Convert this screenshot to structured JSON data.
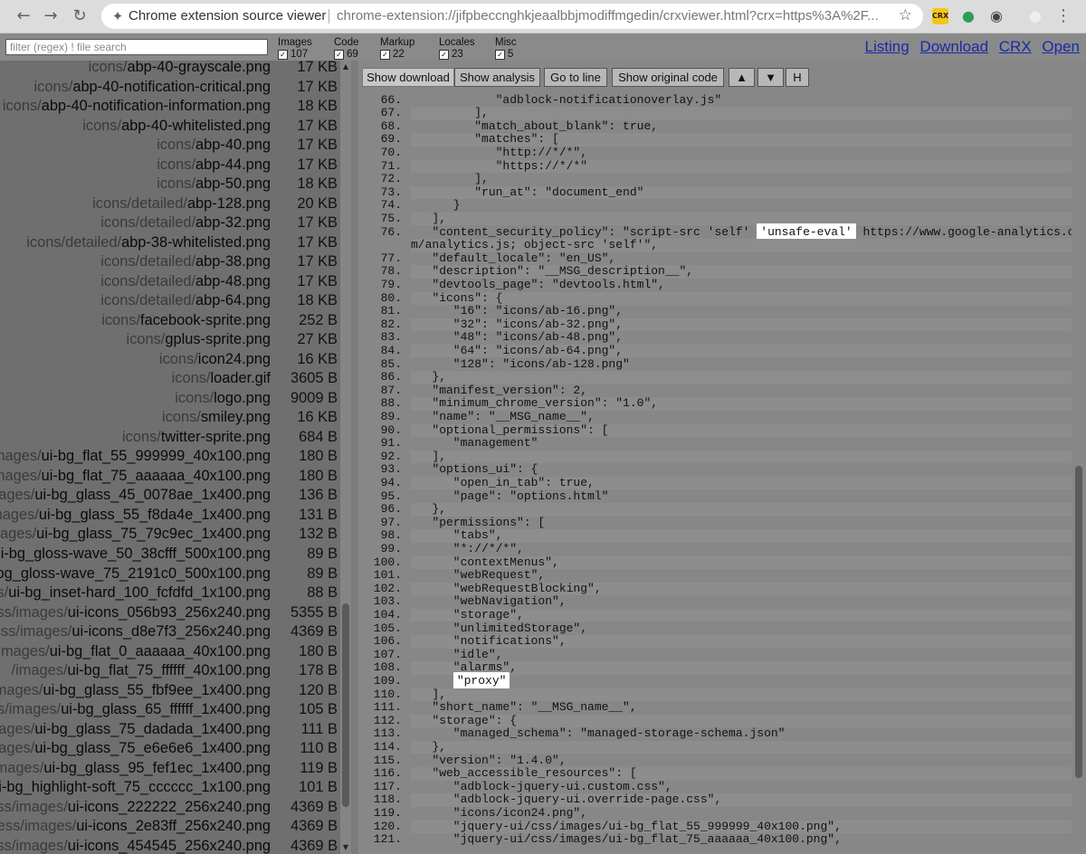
{
  "browser": {
    "tab_title": "Chrome extension source viewer",
    "url": "chrome-extension://jifpbeccnghkjeaalbbjmodiffmgedin/crxviewer.html?crx=https%3A%2F...",
    "nav": {
      "back_icon": "arrow-left-icon",
      "forward_icon": "arrow-right-icon",
      "reload_icon": "reload-icon"
    },
    "extensions": [
      {
        "name": "crx-icon",
        "label": "CRX",
        "color": "#f5c518"
      },
      {
        "name": "green-extension-icon",
        "label": "●",
        "color": "#2e9e57"
      },
      {
        "name": "shield-extension-icon",
        "label": "◉",
        "color": "#444444"
      },
      {
        "name": "account-icon",
        "label": "●",
        "color": "#eeeeee"
      }
    ]
  },
  "toolbar": {
    "filter_placeholder": "filter (regex) ! file search",
    "filters": [
      {
        "label": "Images",
        "count": "107"
      },
      {
        "label": "Code",
        "count": "69"
      },
      {
        "label": "Markup",
        "count": "22"
      },
      {
        "label": "Locales",
        "count": "23"
      },
      {
        "label": "Misc",
        "count": "5"
      }
    ],
    "links": [
      "Listing",
      "Download",
      "CRX",
      "Open"
    ]
  },
  "files": [
    {
      "dir": "icons/",
      "base": "abp-40-grayscale.png",
      "size": "17 KB"
    },
    {
      "dir": "icons/",
      "base": "abp-40-notification-critical.png",
      "size": "17 KB"
    },
    {
      "dir": "icons/",
      "base": "abp-40-notification-information.png",
      "size": "18 KB"
    },
    {
      "dir": "icons/",
      "base": "abp-40-whitelisted.png",
      "size": "17 KB"
    },
    {
      "dir": "icons/",
      "base": "abp-40.png",
      "size": "17 KB"
    },
    {
      "dir": "icons/",
      "base": "abp-44.png",
      "size": "17 KB"
    },
    {
      "dir": "icons/",
      "base": "abp-50.png",
      "size": "18 KB"
    },
    {
      "dir": "icons/detailed/",
      "base": "abp-128.png",
      "size": "20 KB"
    },
    {
      "dir": "icons/detailed/",
      "base": "abp-32.png",
      "size": "17 KB"
    },
    {
      "dir": "icons/detailed/",
      "base": "abp-38-whitelisted.png",
      "size": "17 KB"
    },
    {
      "dir": "icons/detailed/",
      "base": "abp-38.png",
      "size": "17 KB"
    },
    {
      "dir": "icons/detailed/",
      "base": "abp-48.png",
      "size": "17 KB"
    },
    {
      "dir": "icons/detailed/",
      "base": "abp-64.png",
      "size": "18 KB"
    },
    {
      "dir": "icons/",
      "base": "facebook-sprite.png",
      "size": "252 B"
    },
    {
      "dir": "icons/",
      "base": "gplus-sprite.png",
      "size": "27 KB"
    },
    {
      "dir": "icons/",
      "base": "icon24.png",
      "size": "16 KB"
    },
    {
      "dir": "icons/",
      "base": "loader.gif",
      "size": "3605 B"
    },
    {
      "dir": "icons/",
      "base": "logo.png",
      "size": "9009 B"
    },
    {
      "dir": "icons/",
      "base": "smiley.png",
      "size": "16 KB"
    },
    {
      "dir": "icons/",
      "base": "twitter-sprite.png",
      "size": "684 B"
    },
    {
      "dir": "/images/",
      "base": "ui-bg_flat_55_999999_40x100.png",
      "size": "180 B"
    },
    {
      "dir": "/images/",
      "base": "ui-bg_flat_75_aaaaaa_40x100.png",
      "size": "180 B"
    },
    {
      "dir": "images/",
      "base": "ui-bg_glass_45_0078ae_1x400.png",
      "size": "136 B"
    },
    {
      "dir": "images/",
      "base": "ui-bg_glass_55_f8da4e_1x400.png",
      "size": "131 B"
    },
    {
      "dir": "images/",
      "base": "ui-bg_glass_75_79c9ec_1x400.png",
      "size": "132 B"
    },
    {
      "dir": "/",
      "base": "ui-bg_gloss-wave_50_38cfff_500x100.png",
      "size": "89 B"
    },
    {
      "dir": "",
      "base": "ui-bg_gloss-wave_75_2191c0_500x100.png",
      "size": "89 B"
    },
    {
      "dir": "es/",
      "base": "ui-bg_inset-hard_100_fcfdfd_1x100.png",
      "size": "88 B"
    },
    {
      "dir": "/css/images/",
      "base": "ui-icons_056b93_256x240.png",
      "size": "5355 B"
    },
    {
      "dir": "/css/images/",
      "base": "ui-icons_d8e7f3_256x240.png",
      "size": "4369 B"
    },
    {
      "dir": "s/images/",
      "base": "ui-bg_flat_0_aaaaaa_40x100.png",
      "size": "180 B"
    },
    {
      "dir": "/images/",
      "base": "ui-bg_flat_75_ffffff_40x100.png",
      "size": "178 B"
    },
    {
      "dir": "/images/",
      "base": "ui-bg_glass_55_fbf9ee_1x400.png",
      "size": "120 B"
    },
    {
      "dir": "ss/images/",
      "base": "ui-bg_glass_65_ffffff_1x400.png",
      "size": "105 B"
    },
    {
      "dir": "/images/",
      "base": "ui-bg_glass_75_dadada_1x400.png",
      "size": "111 B"
    },
    {
      "dir": "s/images/",
      "base": "ui-bg_glass_75_e6e6e6_1x400.png",
      "size": "110 B"
    },
    {
      "dir": "s/images/",
      "base": "ui-bg_glass_95_fef1ec_1x400.png",
      "size": "119 B"
    },
    {
      "dir": "/",
      "base": "ui-bg_highlight-soft_75_cccccc_1x100.png",
      "size": "101 B"
    },
    {
      "dir": "ness/images/",
      "base": "ui-icons_222222_256x240.png",
      "size": "4369 B"
    },
    {
      "dir": "ness/images/",
      "base": "ui-icons_2e83ff_256x240.png",
      "size": "4369 B"
    },
    {
      "dir": "ness/images/",
      "base": "ui-icons_454545_256x240.png",
      "size": "4369 B"
    }
  ],
  "code_toolbar": {
    "show_download": "Show download",
    "buttons": [
      "Show analysis",
      "Go to line",
      "Show original code",
      "▲",
      "▼",
      "H"
    ]
  },
  "code_lines": [
    {
      "n": "66.",
      "t": "            \"adblock-notificationoverlay.js\""
    },
    {
      "n": "67.",
      "t": "         ],"
    },
    {
      "n": "68.",
      "t": "         \"match_about_blank\": true,"
    },
    {
      "n": "69.",
      "t": "         \"matches\": ["
    },
    {
      "n": "70.",
      "t": "            \"http://*/*\","
    },
    {
      "n": "71.",
      "t": "            \"https://*/*\""
    },
    {
      "n": "72.",
      "t": "         ],"
    },
    {
      "n": "73.",
      "t": "         \"run_at\": \"document_end\""
    },
    {
      "n": "74.",
      "t": "      }"
    },
    {
      "n": "75.",
      "t": "   ],"
    },
    {
      "n": "76.",
      "t": "   \"content_security_policy\": \"script-src 'self' ",
      "hl": "'unsafe-eval'",
      "after": " https://www.google-analytics.co"
    },
    {
      "n": "",
      "t": "m/analytics.js; object-src 'self'\","
    },
    {
      "n": "77.",
      "t": "   \"default_locale\": \"en_US\","
    },
    {
      "n": "78.",
      "t": "   \"description\": \"__MSG_description__\","
    },
    {
      "n": "79.",
      "t": "   \"devtools_page\": \"devtools.html\","
    },
    {
      "n": "80.",
      "t": "   \"icons\": {"
    },
    {
      "n": "81.",
      "t": "      \"16\": \"icons/ab-16.png\","
    },
    {
      "n": "82.",
      "t": "      \"32\": \"icons/ab-32.png\","
    },
    {
      "n": "83.",
      "t": "      \"48\": \"icons/ab-48.png\","
    },
    {
      "n": "84.",
      "t": "      \"64\": \"icons/ab-64.png\","
    },
    {
      "n": "85.",
      "t": "      \"128\": \"icons/ab-128.png\""
    },
    {
      "n": "86.",
      "t": "   },"
    },
    {
      "n": "87.",
      "t": "   \"manifest_version\": 2,"
    },
    {
      "n": "88.",
      "t": "   \"minimum_chrome_version\": \"1.0\","
    },
    {
      "n": "89.",
      "t": "   \"name\": \"__MSG_name__\","
    },
    {
      "n": "90.",
      "t": "   \"optional_permissions\": ["
    },
    {
      "n": "91.",
      "t": "      \"management\""
    },
    {
      "n": "92.",
      "t": "   ],"
    },
    {
      "n": "93.",
      "t": "   \"options_ui\": {"
    },
    {
      "n": "94.",
      "t": "      \"open_in_tab\": true,"
    },
    {
      "n": "95.",
      "t": "      \"page\": \"options.html\""
    },
    {
      "n": "96.",
      "t": "   },"
    },
    {
      "n": "97.",
      "t": "   \"permissions\": ["
    },
    {
      "n": "98.",
      "t": "      \"tabs\","
    },
    {
      "n": "99.",
      "t": "      \"*://*/*\","
    },
    {
      "n": "100.",
      "t": "      \"contextMenus\","
    },
    {
      "n": "101.",
      "t": "      \"webRequest\","
    },
    {
      "n": "102.",
      "t": "      \"webRequestBlocking\","
    },
    {
      "n": "103.",
      "t": "      \"webNavigation\","
    },
    {
      "n": "104.",
      "t": "      \"storage\","
    },
    {
      "n": "105.",
      "t": "      \"unlimitedStorage\","
    },
    {
      "n": "106.",
      "t": "      \"notifications\","
    },
    {
      "n": "107.",
      "t": "      \"idle\","
    },
    {
      "n": "108.",
      "t": "      \"alarms\","
    },
    {
      "n": "109.",
      "t": "      ",
      "hl": "\"proxy\"",
      "after": ""
    },
    {
      "n": "110.",
      "t": "   ],"
    },
    {
      "n": "111.",
      "t": "   \"short_name\": \"__MSG_name__\","
    },
    {
      "n": "112.",
      "t": "   \"storage\": {"
    },
    {
      "n": "113.",
      "t": "      \"managed_schema\": \"managed-storage-schema.json\""
    },
    {
      "n": "114.",
      "t": "   },"
    },
    {
      "n": "115.",
      "t": "   \"version\": \"1.4.0\","
    },
    {
      "n": "116.",
      "t": "   \"web_accessible_resources\": ["
    },
    {
      "n": "117.",
      "t": "      \"adblock-jquery-ui.custom.css\","
    },
    {
      "n": "118.",
      "t": "      \"adblock-jquery-ui.override-page.css\","
    },
    {
      "n": "119.",
      "t": "      \"icons/icon24.png\","
    },
    {
      "n": "120.",
      "t": "      \"jquery-ui/css/images/ui-bg_flat_55_999999_40x100.png\","
    },
    {
      "n": "121.",
      "t": "      \"jquery-ui/css/images/ui-bg_flat_75_aaaaaa_40x100.png\","
    }
  ]
}
